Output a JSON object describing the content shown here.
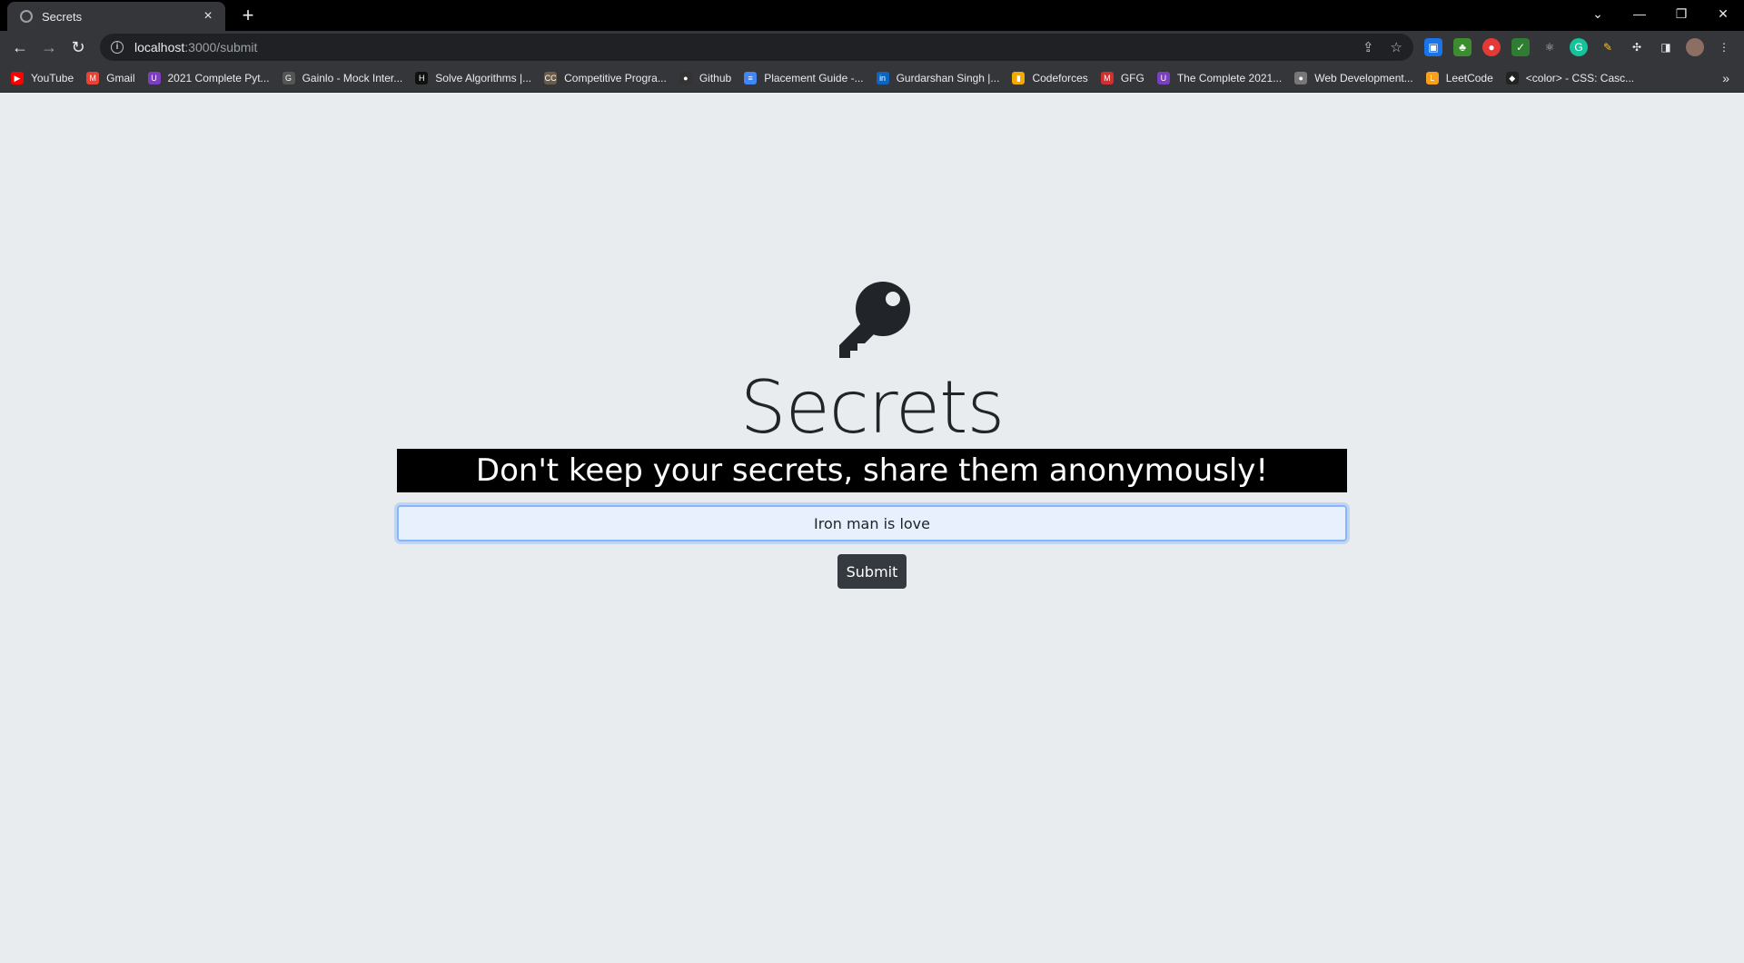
{
  "browser": {
    "tab_title": "Secrets",
    "tab_close": "×",
    "new_tab": "+",
    "url_host": "localhost",
    "url_path": ":3000/submit",
    "bookmarks": [
      {
        "label": "YouTube",
        "color": "#ff0000",
        "glyph": "▶"
      },
      {
        "label": "Gmail",
        "color": "#ea4335",
        "glyph": "M"
      },
      {
        "label": "2021 Complete Pyt...",
        "color": "#7b3fbf",
        "glyph": "U"
      },
      {
        "label": "Gainlo - Mock Inter...",
        "color": "#555555",
        "glyph": "G"
      },
      {
        "label": "Solve Algorithms |...",
        "color": "#111111",
        "glyph": "H"
      },
      {
        "label": "Competitive Progra...",
        "color": "#6b5b4b",
        "glyph": "CC"
      },
      {
        "label": "Github",
        "color": "#333333",
        "glyph": "●"
      },
      {
        "label": "Placement Guide -...",
        "color": "#4285f4",
        "glyph": "≡"
      },
      {
        "label": "Gurdarshan Singh |...",
        "color": "#0a66c2",
        "glyph": "in"
      },
      {
        "label": "Codeforces",
        "color": "#f2a900",
        "glyph": "▮"
      },
      {
        "label": "GFG",
        "color": "#d32f2f",
        "glyph": "M"
      },
      {
        "label": "The Complete 2021...",
        "color": "#7b3fbf",
        "glyph": "U"
      },
      {
        "label": "Web Development...",
        "color": "#777777",
        "glyph": "●"
      },
      {
        "label": "LeetCode",
        "color": "#f89f1b",
        "glyph": "L"
      },
      {
        "label": "<color> - CSS: Casc...",
        "color": "#222222",
        "glyph": "◆"
      }
    ],
    "bookmarks_more": "»"
  },
  "page": {
    "brand": "Secrets",
    "tagline": "Don't keep your secrets, share them anonymously!",
    "secret_value": "Iron man is love",
    "submit_label": "Submit"
  }
}
